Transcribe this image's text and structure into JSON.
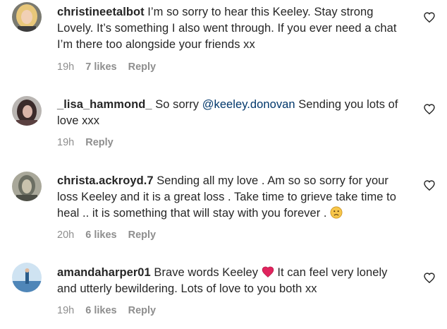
{
  "comments": [
    {
      "username": "christineetalbot",
      "text": "I’m so sorry to hear this Keeley. Stay strong Lovely. It’s something I also went through. If you ever need a chat I’m there too alongside your friends xx",
      "time": "19h",
      "likes": "7 likes",
      "reply": "Reply",
      "avatar_icon": "avatar-blonde-woman"
    },
    {
      "username": "_lisa_hammond_",
      "text_before": "So sorry",
      "mention": "@keeley.donovan",
      "text_after": "Sending you lots of love xxx",
      "time": "19h",
      "reply": "Reply",
      "avatar_icon": "avatar-dark-hair-woman"
    },
    {
      "username": "christa.ackroyd.7",
      "text": "Sending all my love . Am so so sorry for your loss Keeley and it is a great loss . Take time to grieve take time to heal .. it is something that will stay with you forever .",
      "emoji": "sad-face-emoji",
      "time": "20h",
      "likes": "6 likes",
      "reply": "Reply",
      "avatar_icon": "avatar-grey-portrait"
    },
    {
      "username": "amandaharper01",
      "text_before": "Brave words Keeley",
      "emoji": "red-heart-emoji",
      "text_after": "It can feel very lonely and utterly bewildering. Lots of love to you both xx",
      "time": "19h",
      "likes": "6 likes",
      "reply": "Reply",
      "avatar_icon": "avatar-beach-figure"
    }
  ],
  "icons": {
    "like": "heart-outline-icon"
  },
  "colors": {
    "text": "#262626",
    "meta": "#8e8e8e",
    "mention": "#00376b",
    "heart_emoji": "#e0245e"
  }
}
